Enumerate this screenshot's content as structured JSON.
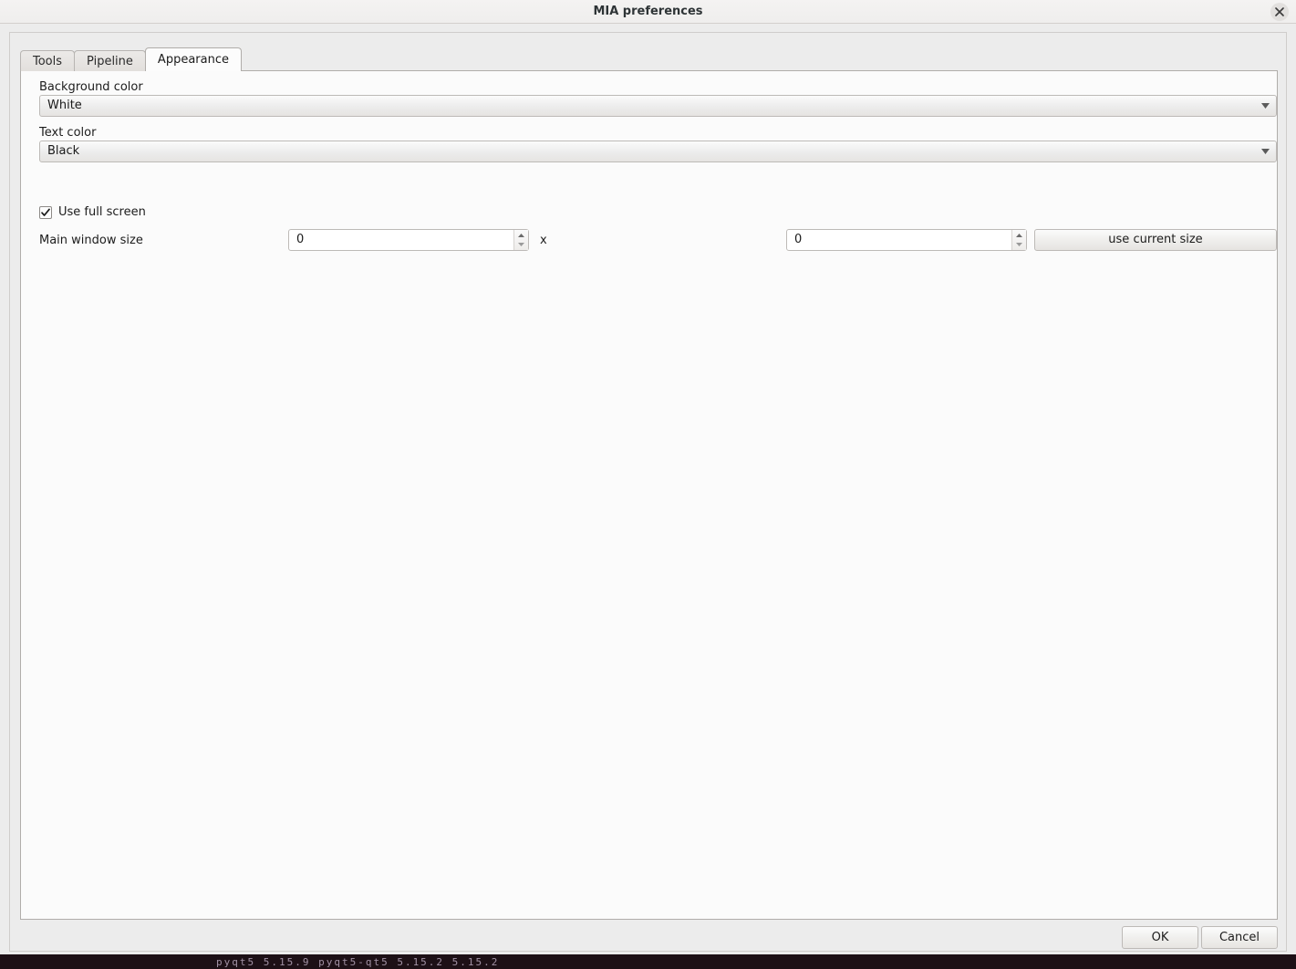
{
  "window": {
    "title": "MIA preferences",
    "close_icon": "close-x-icon"
  },
  "tabs": [
    {
      "label": "Tools",
      "active": false
    },
    {
      "label": "Pipeline",
      "active": false
    },
    {
      "label": "Appearance",
      "active": true
    }
  ],
  "appearance": {
    "background_color": {
      "label": "Background color",
      "value": "White",
      "arrow_icon": "chevron-down-icon"
    },
    "text_color": {
      "label": "Text color",
      "value": "Black",
      "arrow_icon": "chevron-down-icon"
    },
    "use_full_screen": {
      "label": "Use full screen",
      "checked": true,
      "check_icon": "checkmark-icon"
    },
    "main_window_size": {
      "label": "Main window size",
      "width_value": "0",
      "height_value": "0",
      "separator": "x",
      "use_current_size_label": "use current size",
      "spin_up_icon": "triangle-up-icon",
      "spin_down_icon": "triangle-down-icon"
    }
  },
  "actions": {
    "ok_label": "OK",
    "cancel_label": "Cancel"
  },
  "background": {
    "terminal_text": "pyqt5 5.15.9    pyqt5-qt5   5.15.2          5.15.2"
  },
  "colors": {
    "dialog_background": "#ececec",
    "panel_background": "#fbfbfb",
    "titlebar_background": "#f2f1f0",
    "border": "#b0adaa",
    "text": "#1c1c1c"
  }
}
